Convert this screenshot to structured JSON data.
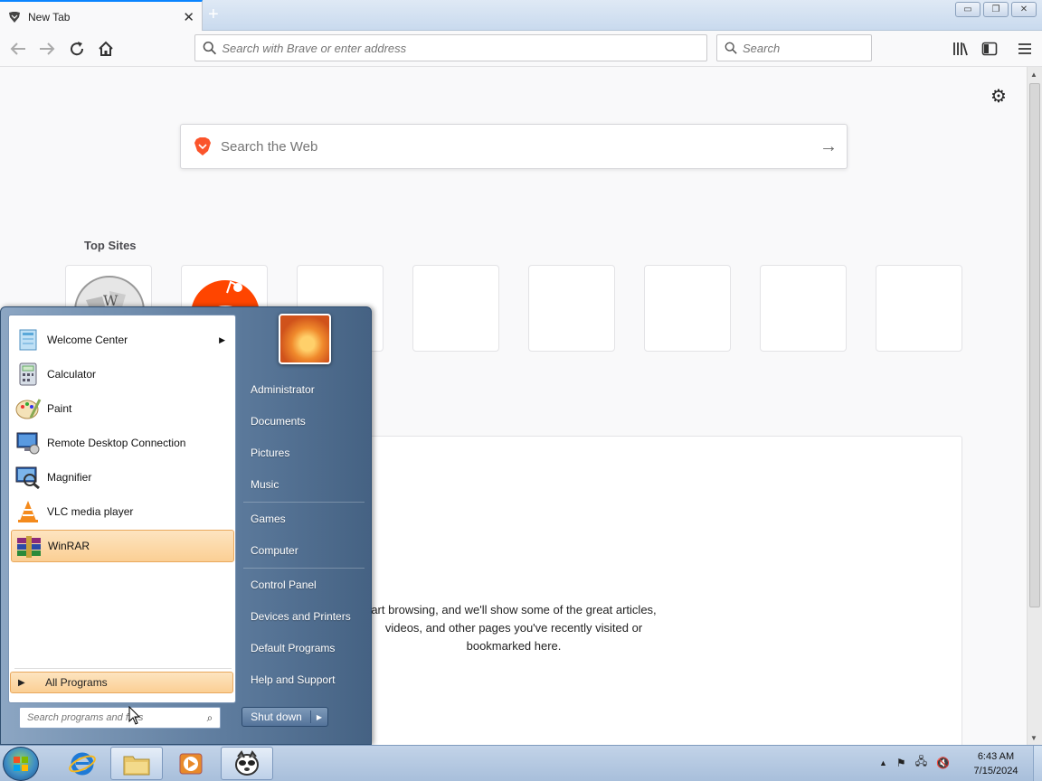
{
  "browser": {
    "tab_title": "New Tab",
    "address_placeholder": "Search with Brave or enter address",
    "search_placeholder": "Search"
  },
  "newtab": {
    "web_search_placeholder": "Search the Web",
    "top_sites_title": "Top Sites",
    "top_sites": [
      {
        "icon": "wikipedia-icon"
      },
      {
        "icon": "reddit-icon"
      },
      {
        "icon": ""
      },
      {
        "icon": ""
      },
      {
        "icon": ""
      },
      {
        "icon": ""
      },
      {
        "icon": ""
      },
      {
        "icon": ""
      }
    ],
    "highlights_message": "art browsing, and we'll show some of the great articles, videos, and other pages you've recently visited or bookmarked here."
  },
  "start_menu": {
    "programs": [
      {
        "label": "Welcome Center",
        "icon": "welcome-center-icon",
        "submenu": true
      },
      {
        "label": "Calculator",
        "icon": "calculator-icon"
      },
      {
        "label": "Paint",
        "icon": "paint-icon"
      },
      {
        "label": "Remote Desktop Connection",
        "icon": "remote-desktop-icon"
      },
      {
        "label": "Magnifier",
        "icon": "magnifier-icon"
      },
      {
        "label": "VLC media player",
        "icon": "vlc-icon"
      },
      {
        "label": "WinRAR",
        "icon": "winrar-icon",
        "selected": true
      }
    ],
    "all_programs_label": "All Programs",
    "search_placeholder": "Search programs and files",
    "right_items": [
      "Administrator",
      "Documents",
      "Pictures",
      "Music",
      "Games",
      "Computer",
      "Control Panel",
      "Devices and Printers",
      "Default Programs",
      "Help and Support"
    ],
    "shutdown_label": "Shut down"
  },
  "taskbar": {
    "pinned": [
      "internet-explorer-icon",
      "windows-explorer-icon",
      "media-player-icon",
      "brave-browser-icon"
    ],
    "clock_time": "6:43 AM",
    "clock_date": "7/15/2024"
  },
  "colors": {
    "accent_blue": "#0a84ff",
    "start_menu_highlight": "#fbcf94",
    "brave_orange": "#fb542b",
    "reddit_orange": "#ff4500"
  }
}
